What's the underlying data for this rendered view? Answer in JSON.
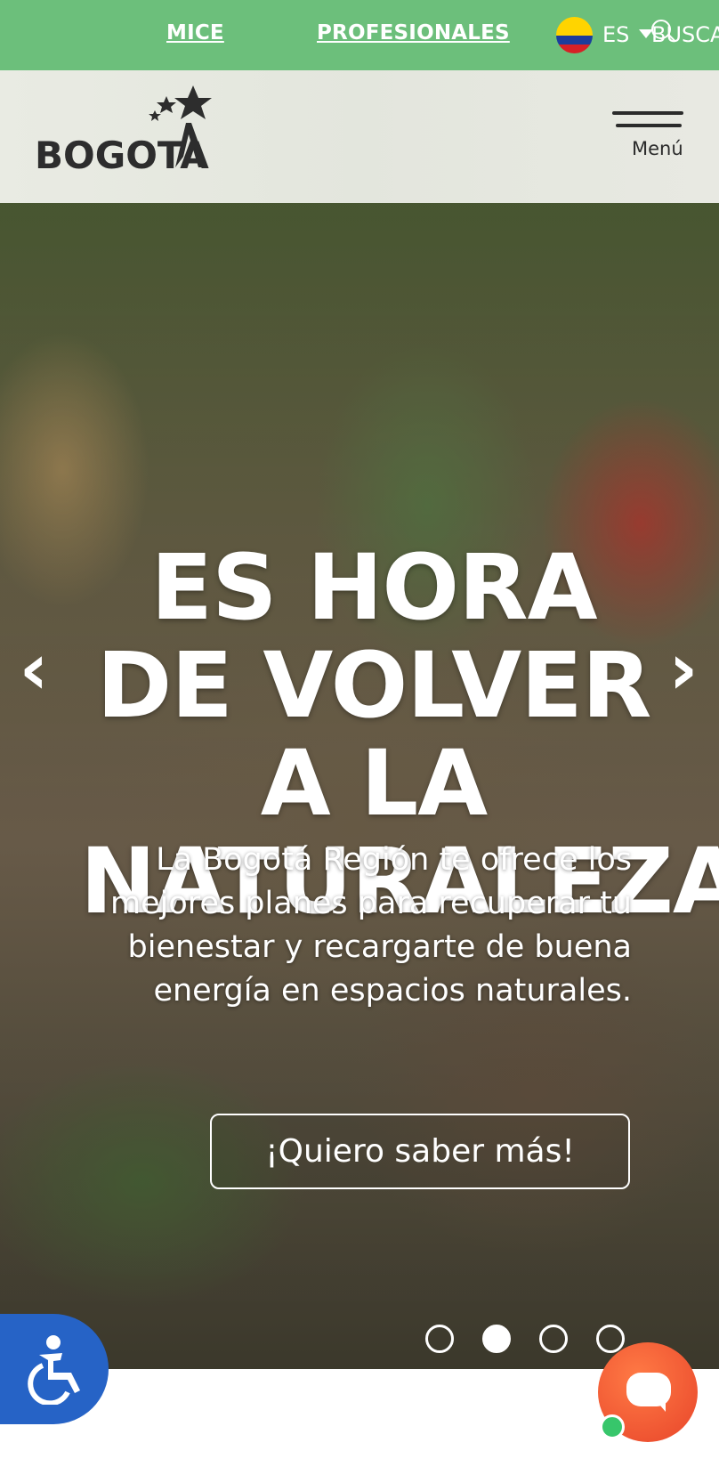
{
  "topbar": {
    "mice": "MICE",
    "profesionales": "PROFESIONALES",
    "language": "ES",
    "search": "BUSCAR"
  },
  "header": {
    "logo": "BOGOTA",
    "menu_label": "Menú"
  },
  "hero": {
    "title": "ES HORA DE VOLVER A LA NATURALEZA",
    "subtitle": "La Bogotá Región te ofrece los mejores planes para recuperar tu bienestar y recargarte de buena energía en espacios naturales.",
    "cta": "¡Quiero saber más!",
    "prev": "‹",
    "next": "›",
    "slides": 4,
    "active_slide": 2
  },
  "colors": {
    "topbar": "#6cbf7b",
    "accessibility": "#2663c6",
    "chat": "#e8452a",
    "online": "#37c66b"
  },
  "icons": {
    "accessibility": "accessibility-icon",
    "chat": "chat-icon",
    "search": "search-icon",
    "flag": "colombia-flag-icon"
  }
}
